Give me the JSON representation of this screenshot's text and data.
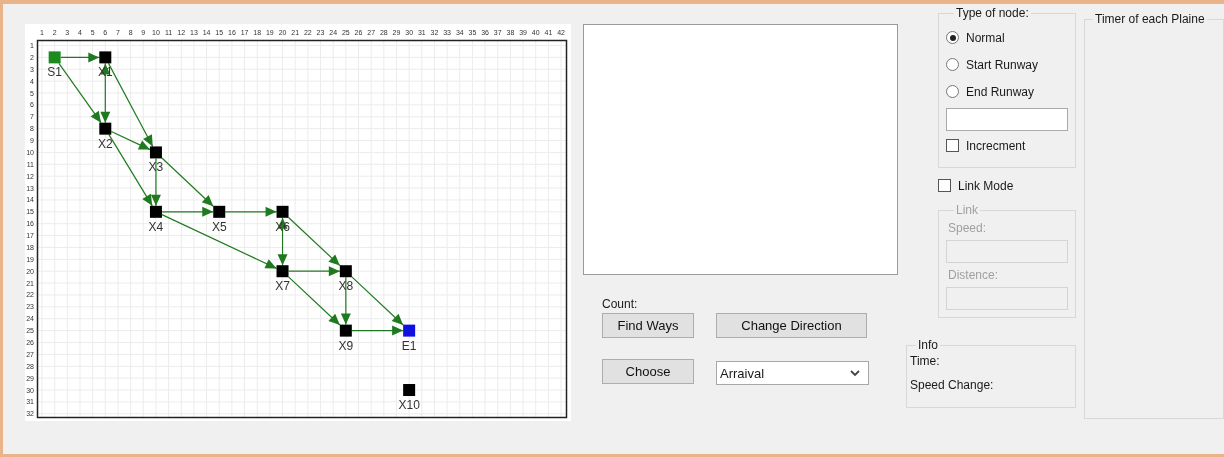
{
  "canvas": {
    "columns": [
      "1",
      "2",
      "3",
      "4",
      "5",
      "6",
      "7",
      "8",
      "9",
      "10",
      "11",
      "12",
      "13",
      "14",
      "15",
      "16",
      "17",
      "18",
      "19",
      "20",
      "21",
      "22",
      "23",
      "24",
      "25",
      "26",
      "27",
      "28",
      "29",
      "30",
      "31",
      "32",
      "33",
      "34",
      "35",
      "36",
      "37",
      "38",
      "39",
      "40",
      "41",
      "42"
    ],
    "rows": [
      "1",
      "2",
      "3",
      "4",
      "5",
      "6",
      "7",
      "8",
      "9",
      "10",
      "11",
      "12",
      "13",
      "14",
      "15",
      "16",
      "17",
      "18",
      "19",
      "20",
      "21",
      "22",
      "23",
      "24",
      "25",
      "26",
      "27",
      "28",
      "29",
      "30",
      "31",
      "32"
    ],
    "nodes": [
      {
        "label": "S1",
        "kind": "start"
      },
      {
        "label": "X1",
        "kind": "normal"
      },
      {
        "label": "X2",
        "kind": "normal"
      },
      {
        "label": "X3",
        "kind": "normal"
      },
      {
        "label": "X4",
        "kind": "normal"
      },
      {
        "label": "X5",
        "kind": "normal"
      },
      {
        "label": "X6",
        "kind": "normal"
      },
      {
        "label": "X7",
        "kind": "normal"
      },
      {
        "label": "X8",
        "kind": "normal"
      },
      {
        "label": "X9",
        "kind": "normal"
      },
      {
        "label": "E1",
        "kind": "end"
      },
      {
        "label": "X10",
        "kind": "normal"
      }
    ]
  },
  "count_label": "Count:",
  "buttons": {
    "find_ways": "Find Ways",
    "change_direction": "Change Direction",
    "choose": "Choose"
  },
  "dropdown": {
    "value": "Arraival"
  },
  "node_type": {
    "title": "Type of node:",
    "options": [
      {
        "label": "Normal",
        "selected": true
      },
      {
        "label": "Start Runway",
        "selected": false
      },
      {
        "label": "End Runway",
        "selected": false
      }
    ],
    "increment": {
      "label": "Increcment",
      "checked": false
    }
  },
  "link_mode": {
    "label": "Link Mode",
    "checked": false
  },
  "link": {
    "title": "Link",
    "disabled": true,
    "fields": [
      {
        "label": "Speed:"
      },
      {
        "label": "Distence:"
      }
    ]
  },
  "info": {
    "title": "Info",
    "lines": [
      "Time:",
      "Speed Change:"
    ]
  },
  "timer": {
    "title": "Timer of each Plaine"
  }
}
